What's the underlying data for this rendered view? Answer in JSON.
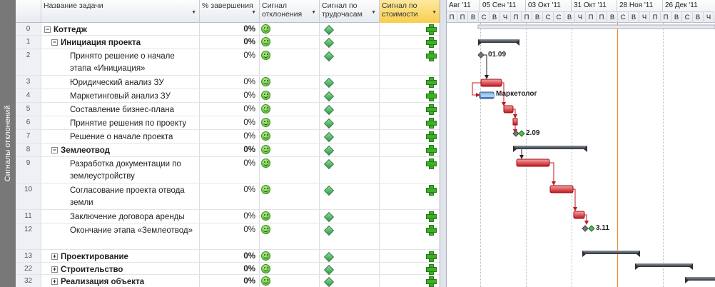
{
  "side_label": "Сигналы отклонений",
  "columns": {
    "name": "Название задачи",
    "pct": "% завершения",
    "sig_var": "Сигнал отклонения",
    "sig_work": "Сигнал по трудочасам",
    "sig_cost": "Сигнал по стоимости"
  },
  "rows": [
    {
      "id": "0",
      "name": "Коттедж",
      "pct": "0%"
    },
    {
      "id": "1",
      "name": "Инициация проекта",
      "pct": "0%"
    },
    {
      "id": "2",
      "name": "Принято решение о начале этапа «Инициация»",
      "pct": "0%"
    },
    {
      "id": "3",
      "name": "Юридический анализ ЗУ",
      "pct": "0%"
    },
    {
      "id": "4",
      "name": "Маркетинговый анализ ЗУ",
      "pct": "0%"
    },
    {
      "id": "5",
      "name": "Составление бизнес-плана",
      "pct": "0%"
    },
    {
      "id": "6",
      "name": "Принятие решения по проекту",
      "pct": "0%"
    },
    {
      "id": "7",
      "name": "Решение о начале проекта",
      "pct": "0%"
    },
    {
      "id": "8",
      "name": "Землеотвод",
      "pct": "0%"
    },
    {
      "id": "9",
      "name": "Разработка документации по землеустройству",
      "pct": "0%"
    },
    {
      "id": "10",
      "name": "Согласование проекта отвода земли",
      "pct": "0%"
    },
    {
      "id": "11",
      "name": "Заключение договора аренды",
      "pct": "0%"
    },
    {
      "id": "12",
      "name": "Окончание этапа «Землеотвод»",
      "pct": "0%"
    },
    {
      "id": "13",
      "name": "Проектирование",
      "pct": "0%"
    },
    {
      "id": "22",
      "name": "Строительство",
      "pct": "0%"
    },
    {
      "id": "32",
      "name": "Реализация объекта",
      "pct": "0%"
    }
  ],
  "timescale": {
    "weeks": [
      "Авг '11",
      "05 Сен '11",
      "03 Окт '11",
      "31 Окт '11",
      "28 Ноя '11",
      "26 Дек '11"
    ],
    "days": [
      "П",
      "П",
      "В",
      "С",
      "В",
      "Ч",
      "П",
      "П",
      "В",
      "С",
      "С",
      "В",
      "Ч",
      "П",
      "П",
      "В",
      "С",
      "В",
      "Ч",
      "П",
      "П",
      "В",
      "С",
      "В",
      "Ч"
    ]
  },
  "gantt_labels": {
    "m1": "01.09",
    "res": "Маркетолог",
    "m2": "2.09",
    "m3": "3.11"
  },
  "colors": {
    "header_selected": "#f9cd4e",
    "critical_bar": "#d9242b",
    "task_bar": "#4f7fc9",
    "summary_bar": "#3a3f47",
    "today_line": "#e58a3a",
    "signal_green": "#3fae2a"
  }
}
